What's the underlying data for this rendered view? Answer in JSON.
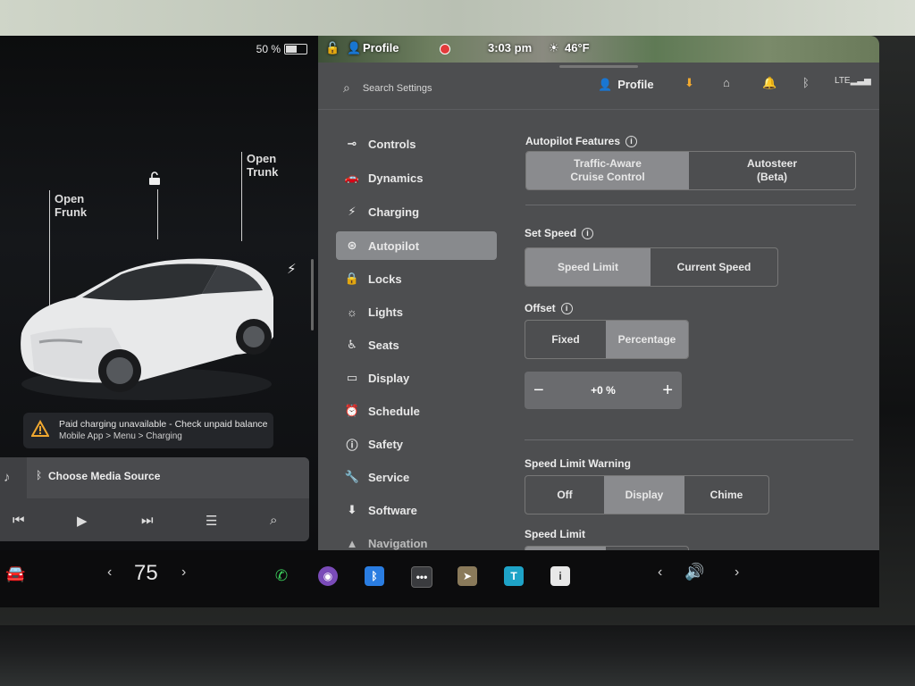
{
  "status": {
    "battery": "50 %",
    "battery_level": 0.5,
    "profile": "Profile",
    "time": "3:03 pm",
    "temperature": "46°F"
  },
  "car": {
    "frunk_label_1": "Open",
    "frunk_label_2": "Frunk",
    "trunk_label_1": "Open",
    "trunk_label_2": "Trunk"
  },
  "alert": {
    "title": "Paid charging unavailable - Check unpaid balance",
    "subtitle": "Mobile App > Menu > Charging"
  },
  "media": {
    "source": "Choose Media Source"
  },
  "header": {
    "search_placeholder": "Search Settings",
    "profile": "Profile"
  },
  "nav": {
    "items": [
      {
        "label": "Controls"
      },
      {
        "label": "Dynamics"
      },
      {
        "label": "Charging"
      },
      {
        "label": "Autopilot"
      },
      {
        "label": "Locks"
      },
      {
        "label": "Lights"
      },
      {
        "label": "Seats"
      },
      {
        "label": "Display"
      },
      {
        "label": "Schedule"
      },
      {
        "label": "Safety"
      },
      {
        "label": "Service"
      },
      {
        "label": "Software"
      },
      {
        "label": "Navigation"
      }
    ]
  },
  "autopilot": {
    "features_title": "Autopilot Features",
    "features_opt1_line1": "Traffic-Aware",
    "features_opt1_line2": "Cruise Control",
    "features_opt2_line1": "Autosteer",
    "features_opt2_line2": "(Beta)",
    "set_speed_title": "Set Speed",
    "set_speed_opt1": "Speed Limit",
    "set_speed_opt2": "Current Speed",
    "offset_title": "Offset",
    "offset_opt1": "Fixed",
    "offset_opt2": "Percentage",
    "offset_value": "+0 %",
    "warning_title": "Speed Limit Warning",
    "warning_opt1": "Off",
    "warning_opt2": "Display",
    "warning_opt3": "Chime",
    "speed_limit_title": "Speed Limit"
  },
  "taskbar": {
    "temp": "75",
    "left_arrow": "‹",
    "right_arrow": "›"
  }
}
